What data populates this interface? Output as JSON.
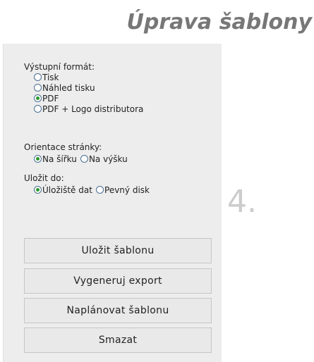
{
  "header": {
    "title": "Úprava šablony"
  },
  "step": {
    "number": "4."
  },
  "format": {
    "label": "Výstupní formát:",
    "options": [
      "Tisk",
      "Náhled tisku",
      "PDF",
      "PDF + Logo distributora"
    ],
    "selected": "PDF"
  },
  "orientation": {
    "label": "Orientace stránky:",
    "options": [
      "Na šířku",
      "Na výšku"
    ],
    "selected": "Na šířku"
  },
  "save_to": {
    "label": "Uložit do:",
    "options": [
      "Úložiště dat",
      "Pevný disk"
    ],
    "selected": "Úložiště dat"
  },
  "buttons": {
    "save": "Uložit šablonu",
    "export": "Vygeneruj export",
    "schedule": "Naplánovat šablonu",
    "delete": "Smazat"
  },
  "colors": {
    "title": "#777777",
    "panel": "#ededed",
    "radio_dot": "#2a9a2a"
  }
}
